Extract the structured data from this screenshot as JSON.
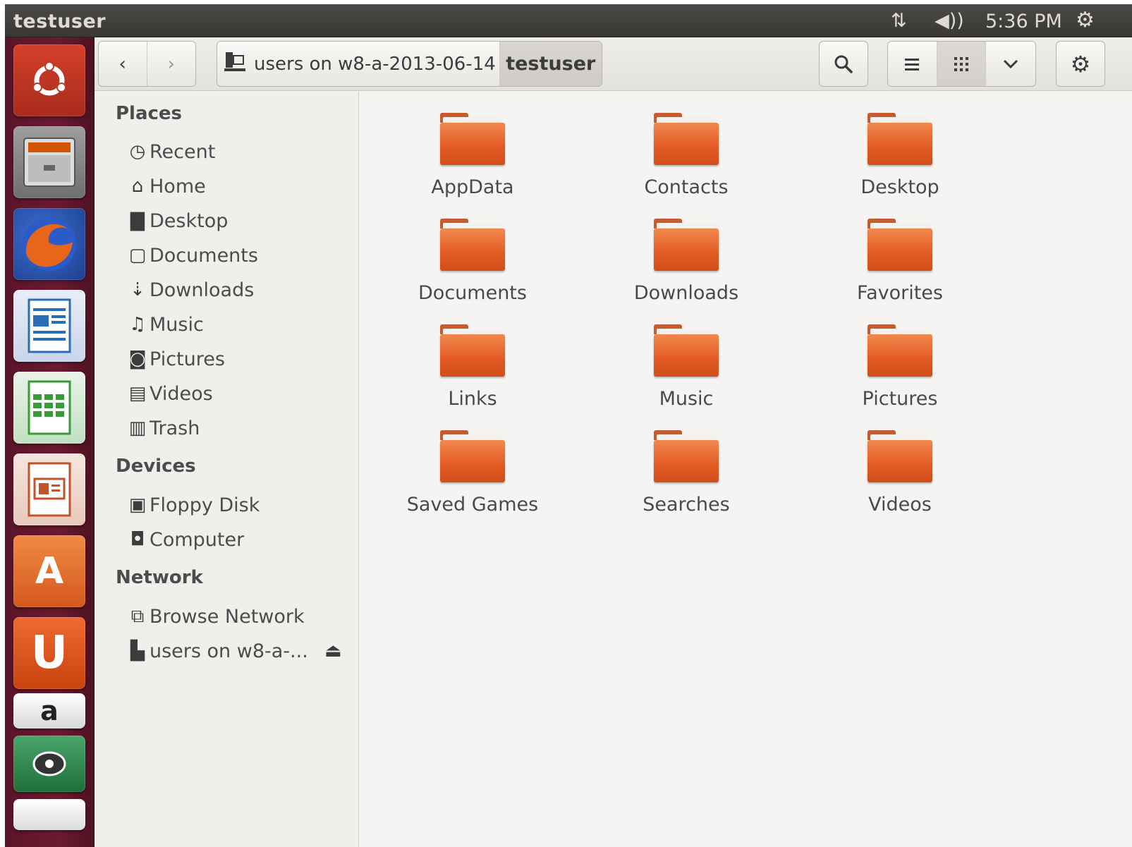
{
  "top_panel": {
    "title": "testuser",
    "network_icon": "network-arrows-icon",
    "volume_icon": "volume-icon",
    "clock": "5:36 PM",
    "session_icon": "gear-icon"
  },
  "launcher": {
    "items": [
      {
        "name": "ubuntu-dash",
        "icon": "ubuntu-logo-icon",
        "color": "#c0392b"
      },
      {
        "name": "files",
        "icon": "file-cabinet-icon",
        "color": "#8a8a8a"
      },
      {
        "name": "firefox",
        "icon": "firefox-icon",
        "color": "#e66000"
      },
      {
        "name": "libreoffice-writer",
        "icon": "writer-icon",
        "color": "#2a6fb6"
      },
      {
        "name": "libreoffice-calc",
        "icon": "calc-icon",
        "color": "#3a9a3a"
      },
      {
        "name": "libreoffice-impress",
        "icon": "impress-icon",
        "color": "#c0532b"
      },
      {
        "name": "software-center",
        "icon": "shopping-bag-icon",
        "color": "#e06a26"
      },
      {
        "name": "ubuntu-one",
        "icon": "ubuntu-one-icon",
        "color": "#dd4814"
      },
      {
        "name": "amazon",
        "icon": "amazon-icon",
        "color": "#f0f0f0"
      },
      {
        "name": "mahjongg",
        "icon": "game-icon",
        "color": "#2e8b57"
      }
    ]
  },
  "toolbar": {
    "back_label": "‹",
    "forward_label": "›",
    "path_segments": [
      "users on w8-a-2013-06-14",
      "testuser"
    ],
    "search_icon": "search-icon",
    "list_view_icon": "list-view-icon",
    "grid_view_icon": "grid-view-icon",
    "view_menu_icon": "chevron-down-icon",
    "settings_icon": "gear-icon"
  },
  "sidebar": {
    "places_heading": "Places",
    "places": [
      {
        "label": "Recent",
        "icon": "clock-icon"
      },
      {
        "label": "Home",
        "icon": "home-icon"
      },
      {
        "label": "Desktop",
        "icon": "folder-icon"
      },
      {
        "label": "Documents",
        "icon": "document-icon"
      },
      {
        "label": "Downloads",
        "icon": "download-icon"
      },
      {
        "label": "Music",
        "icon": "music-icon"
      },
      {
        "label": "Pictures",
        "icon": "camera-icon"
      },
      {
        "label": "Videos",
        "icon": "film-icon"
      },
      {
        "label": "Trash",
        "icon": "trash-icon"
      }
    ],
    "devices_heading": "Devices",
    "devices": [
      {
        "label": "Floppy Disk",
        "icon": "floppy-icon"
      },
      {
        "label": "Computer",
        "icon": "computer-icon"
      }
    ],
    "network_heading": "Network",
    "network": [
      {
        "label": "Browse Network",
        "icon": "network-icon"
      },
      {
        "label": "users on w8-a-...",
        "icon": "network-share-icon"
      }
    ],
    "eject_icon": "eject-icon"
  },
  "content": {
    "folders": [
      "AppData",
      "Contacts",
      "Desktop",
      "Documents",
      "Downloads",
      "Favorites",
      "Links",
      "Music",
      "Pictures",
      "Saved Games",
      "Searches",
      "Videos"
    ]
  }
}
